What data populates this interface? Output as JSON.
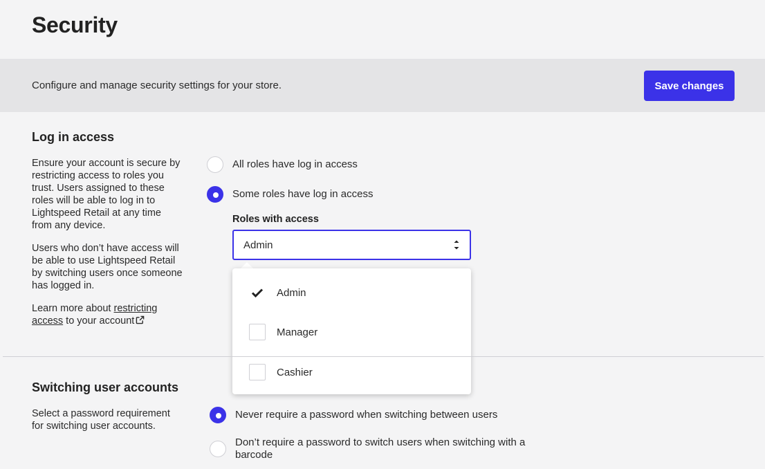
{
  "header": {
    "title": "Security"
  },
  "banner": {
    "description": "Configure and manage security settings for your store.",
    "save_label": "Save changes"
  },
  "login_access": {
    "title": "Log in access",
    "paragraph1": "Ensure your account is secure by restricting access to roles you trust. Users assigned to these roles will be able to log in to Lightspeed Retail at any time from any device.",
    "paragraph2": "Users who don’t have access will be able to use Lightspeed Retail by switching users once someone has logged in.",
    "learn_prefix": "Learn more about ",
    "learn_link": "restricting access",
    "learn_suffix": " to your account",
    "options": [
      {
        "label": "All roles have log in access",
        "checked": false
      },
      {
        "label": "Some roles have log in access",
        "checked": true
      }
    ],
    "roles_label": "Roles with access",
    "roles_value": "Admin",
    "roles_options": [
      {
        "label": "Admin",
        "checked": true
      },
      {
        "label": "Manager",
        "checked": false
      },
      {
        "label": "Cashier",
        "checked": false
      }
    ]
  },
  "switching": {
    "title": "Switching user accounts",
    "description": "Select a password requirement for switching user accounts.",
    "options": [
      {
        "label": "Never require a password when switching between users",
        "checked": true
      },
      {
        "label": "Don’t require a password to switch users when switching with a barcode",
        "checked": false
      }
    ]
  },
  "colors": {
    "accent": "#3b32e8",
    "banner_bg": "#e4e4e6",
    "page_bg": "#f4f4f5"
  },
  "icons": {
    "external_link": "external-link-icon",
    "checkmark": "checkmark-icon",
    "select_arrows": "up-down-arrows-icon"
  }
}
